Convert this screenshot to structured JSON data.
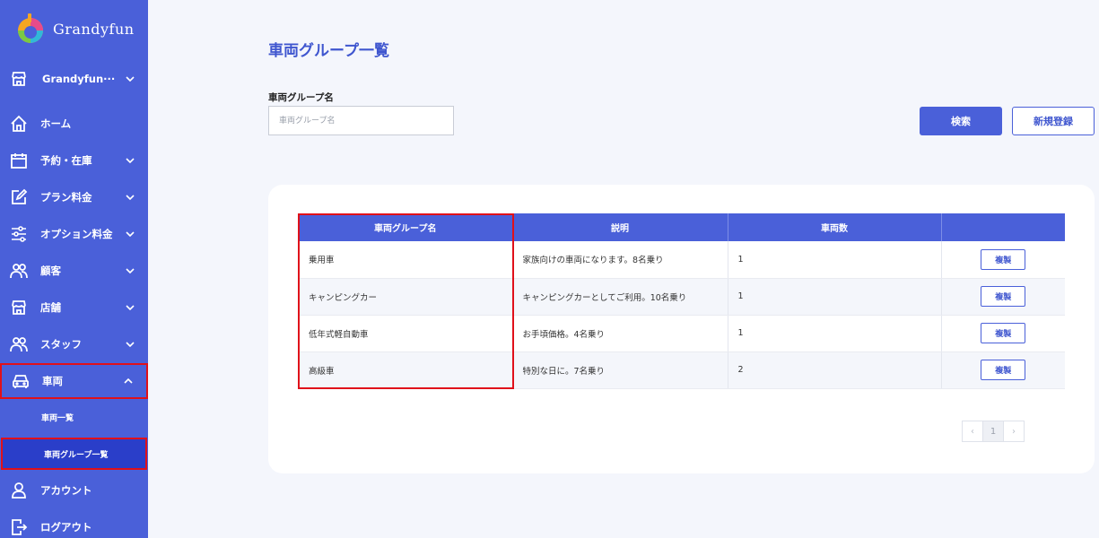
{
  "app": {
    "name": "Grandyfun"
  },
  "sidebar": {
    "store_selector": "Grandyfun···",
    "items": [
      {
        "label": "ホーム"
      },
      {
        "label": "予約・在庫"
      },
      {
        "label": "プラン料金"
      },
      {
        "label": "オプション料金"
      },
      {
        "label": "顧客"
      },
      {
        "label": "店舗"
      },
      {
        "label": "スタッフ"
      },
      {
        "label": "車両"
      }
    ],
    "sub_items": [
      {
        "label": "車両一覧"
      },
      {
        "label": "車両グループ一覧"
      }
    ],
    "bottom_items": [
      {
        "label": "アカウント"
      },
      {
        "label": "ログアウト"
      }
    ]
  },
  "main": {
    "title": "車両グループ一覧",
    "filter": {
      "label": "車両グループ名",
      "value": "",
      "placeholder": "車両グループ名"
    },
    "search_button": "検索",
    "new_button": "新規登録"
  },
  "table": {
    "headers": [
      "車両グループ名",
      "説明",
      "車両数",
      ""
    ],
    "rows": [
      {
        "name": "乗用車",
        "description": "家族向けの車両になります。8名乗り",
        "count": "1",
        "action": "複製"
      },
      {
        "name": "キャンピングカー",
        "description": "キャンピングカーとしてご利用。10名乗り",
        "count": "1",
        "action": "複製"
      },
      {
        "name": "低年式軽自動車",
        "description": "お手頃価格。4名乗り",
        "count": "1",
        "action": "複製"
      },
      {
        "name": "高級車",
        "description": "特別な日に。7名乗り",
        "count": "2",
        "action": "複製"
      }
    ]
  },
  "pagination": {
    "prev": "‹",
    "current": "1",
    "next": "›"
  },
  "colors": {
    "primary": "#4a60d9",
    "highlight": "#e0101a",
    "title": "#3f56cf"
  }
}
